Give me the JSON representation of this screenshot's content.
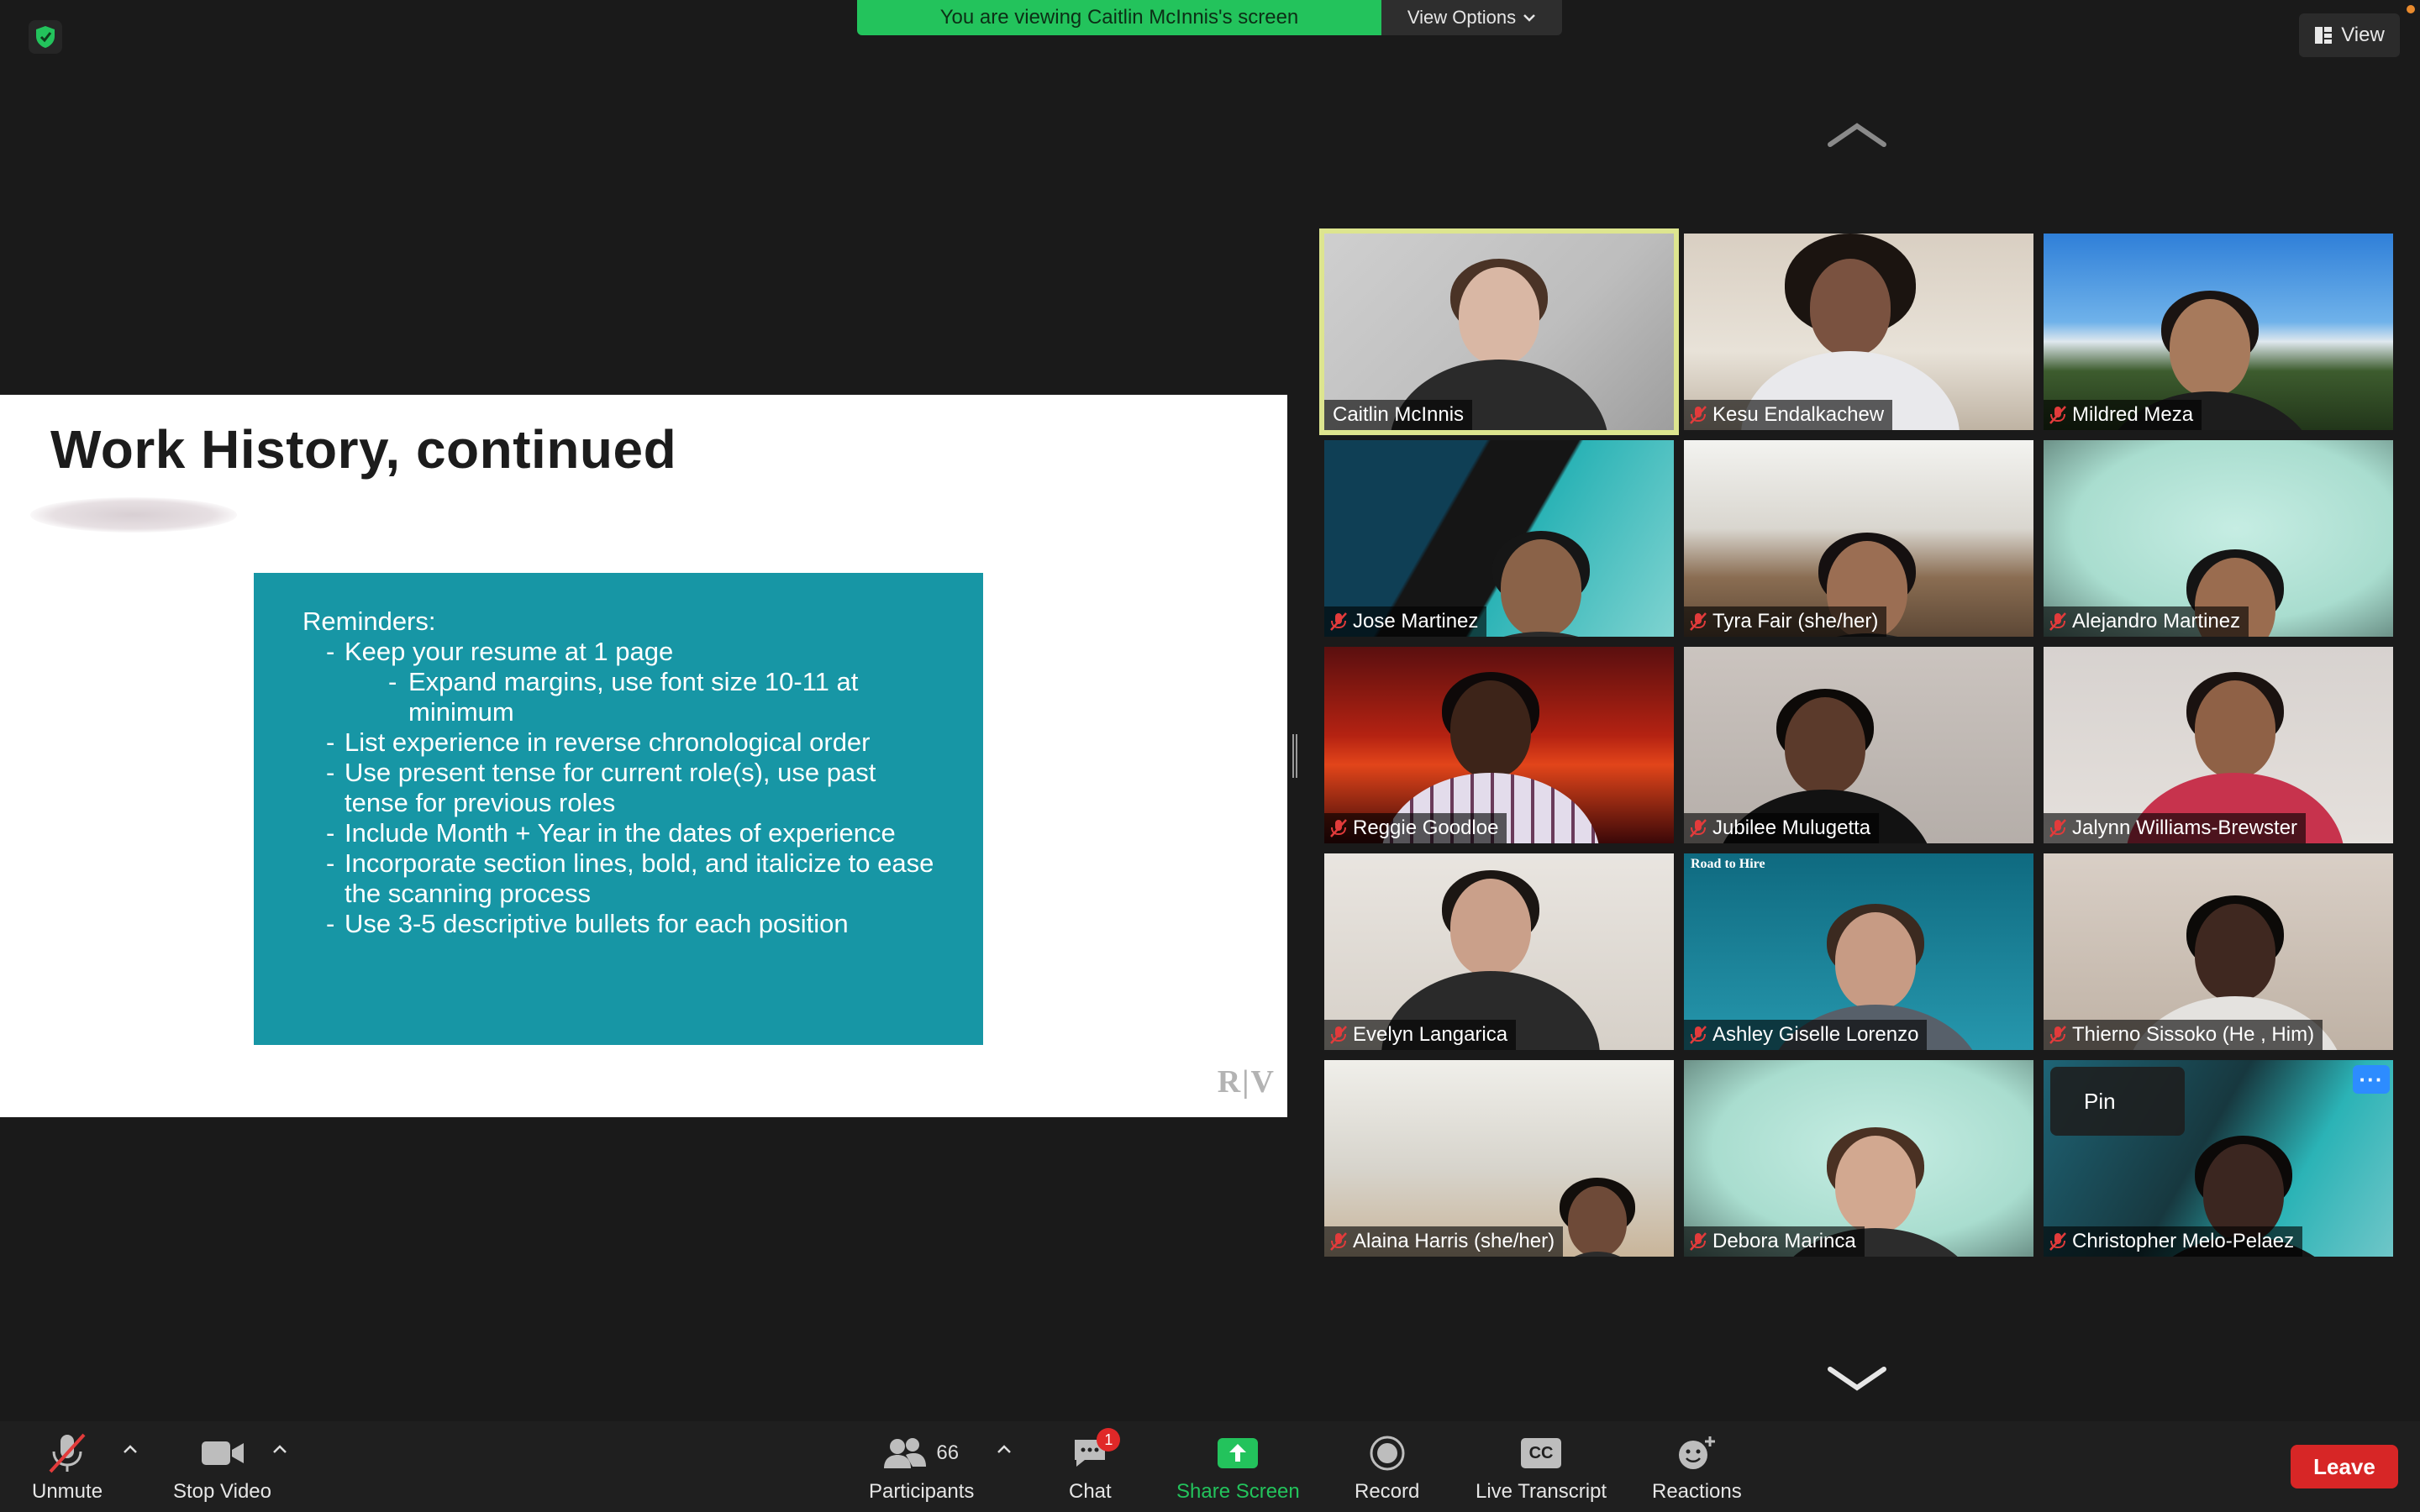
{
  "banner": {
    "text": "You are viewing Caitlin McInnis's screen",
    "view_options": "View Options"
  },
  "view_button": "View",
  "slide": {
    "title": "Work History, continued",
    "box_heading": "Reminders:",
    "items": [
      {
        "dash": "-",
        "text": "Keep your resume at 1 page"
      },
      {
        "dash": "-",
        "text": "Expand margins, use font size 10-11 at minimum",
        "sub": true
      },
      {
        "dash": "-",
        "text": "List experience in reverse chronological order"
      },
      {
        "dash": "-",
        "text": "Use present tense for current role(s), use past tense for previous roles"
      },
      {
        "dash": "-",
        "text": "Include Month + Year in the dates of experience"
      },
      {
        "dash": "-",
        "text": "Incorporate section lines, bold, and italicize to ease the scanning process"
      },
      {
        "dash": "-",
        "text": "Use 3-5 descriptive bullets for each position"
      }
    ],
    "logo": "R|V"
  },
  "participants": [
    {
      "name": "Caitlin McInnis",
      "muted": false
    },
    {
      "name": "Kesu Endalkachew",
      "muted": true
    },
    {
      "name": "Mildred Meza",
      "muted": true
    },
    {
      "name": "Jose Martinez",
      "muted": true
    },
    {
      "name": "Tyra Fair (she/her)",
      "muted": true
    },
    {
      "name": "Alejandro Martinez",
      "muted": true
    },
    {
      "name": "Reggie Goodloe",
      "muted": true
    },
    {
      "name": "Jubilee Mulugetta",
      "muted": true
    },
    {
      "name": "Jalynn Williams-Brewster",
      "muted": true
    },
    {
      "name": "Evelyn Langarica",
      "muted": true
    },
    {
      "name": "Ashley Giselle Lorenzo",
      "muted": true
    },
    {
      "name": "Thierno Sissoko  (He , Him)",
      "muted": true
    },
    {
      "name": "Alaina Harris  (she/her)",
      "muted": true
    },
    {
      "name": "Debora Marinca",
      "muted": true
    },
    {
      "name": "Christopher Melo-Pelaez",
      "muted": true
    }
  ],
  "tile_menu": {
    "pin_label": "Pin",
    "more_label": "···"
  },
  "ashley_bg_text": "Road to Hire",
  "toolbar": {
    "unmute": "Unmute",
    "stop_video": "Stop Video",
    "participants": "Participants",
    "participants_count": "66",
    "chat": "Chat",
    "chat_badge": "1",
    "share_screen": "Share Screen",
    "record": "Record",
    "live_transcript": "Live Transcript",
    "cc_icon_text": "CC",
    "reactions": "Reactions",
    "leave": "Leave"
  },
  "colors": {
    "banner_green": "#23c35c",
    "active_speaker_outline": "#dde58f",
    "slide_box_teal": "#1796a5",
    "share_green": "#23c35c",
    "leave_red": "#d72626",
    "muted_red": "#e23b3b"
  }
}
